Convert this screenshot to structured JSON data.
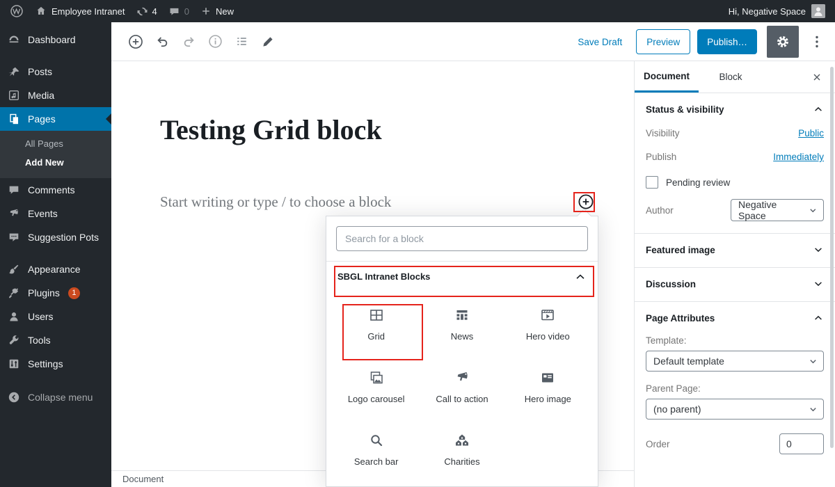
{
  "admin_bar": {
    "site_name": "Employee Intranet",
    "updates_count": "4",
    "comments_count": "0",
    "new_label": "New",
    "greeting": "Hi, Negative Space"
  },
  "nav": {
    "items": [
      {
        "label": "Dashboard"
      },
      {
        "label": "Posts"
      },
      {
        "label": "Media"
      },
      {
        "label": "Pages"
      },
      {
        "label": "Comments"
      },
      {
        "label": "Events"
      },
      {
        "label": "Suggestion Pots"
      },
      {
        "label": "Appearance"
      },
      {
        "label": "Plugins",
        "badge": "1"
      },
      {
        "label": "Users"
      },
      {
        "label": "Tools"
      },
      {
        "label": "Settings"
      },
      {
        "label": "Collapse menu"
      }
    ],
    "submenu": [
      "All Pages",
      "Add New"
    ]
  },
  "toolbar": {
    "save_draft": "Save Draft",
    "preview": "Preview",
    "publish": "Publish…"
  },
  "content": {
    "title": "Testing Grid block",
    "body_placeholder": "Start writing or type / to choose a block"
  },
  "inserter": {
    "search_placeholder": "Search for a block",
    "section_title": "SBGL Intranet Blocks",
    "blocks": [
      "Grid",
      "News",
      "Hero video",
      "Logo carousel",
      "Call to action",
      "Hero image",
      "Search bar",
      "Charities"
    ]
  },
  "doc_sidebar": {
    "tabs": [
      "Document",
      "Block"
    ],
    "status": {
      "title": "Status & visibility",
      "visibility_label": "Visibility",
      "visibility_value": "Public",
      "publish_label": "Publish",
      "publish_value": "Immediately",
      "pending_review_label": "Pending review",
      "author_label": "Author",
      "author_value": "Negative Space"
    },
    "featured_image_title": "Featured image",
    "discussion_title": "Discussion",
    "page_attributes": {
      "title": "Page Attributes",
      "template_label": "Template:",
      "template_value": "Default template",
      "parent_label": "Parent Page:",
      "parent_value": "(no parent)",
      "order_label": "Order",
      "order_value": "0"
    }
  },
  "footer": {
    "breadcrumb": "Document"
  },
  "colors": {
    "accent": "#007cba",
    "menu_highlight": "#0073aa",
    "annotation": "#e5231b",
    "badge": "#ca4a1f",
    "admin_bar_bg": "#23282d"
  }
}
